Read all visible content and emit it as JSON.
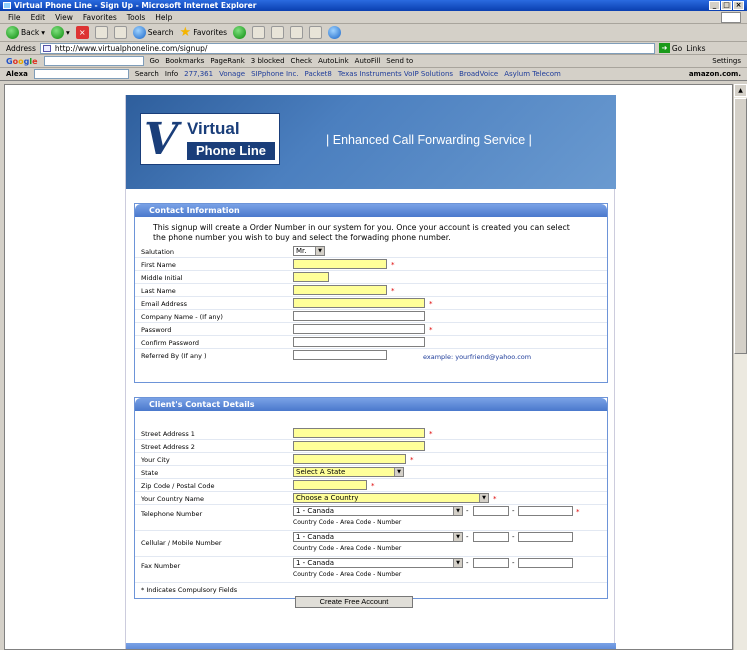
{
  "window": {
    "title": "Virtual Phone Line - Sign Up - Microsoft Internet Explorer"
  },
  "menu": [
    "File",
    "Edit",
    "View",
    "Favorites",
    "Tools",
    "Help"
  ],
  "toolbar": {
    "back": "Back",
    "search": "Search",
    "favorites": "Favorites"
  },
  "address": {
    "label": "Address",
    "url": "http://www.virtualphoneline.com/signup/",
    "go": "Go",
    "links": "Links"
  },
  "google_bar": {
    "go": "Go",
    "bookmarks": "Bookmarks",
    "pagerank": "PageRank",
    "blocked": "3 blocked",
    "check": "Check",
    "autolink": "AutoLink",
    "autofill": "AutoFill",
    "sendto": "Send to",
    "settings": "Settings"
  },
  "alexa_bar": {
    "label": "Alexa",
    "search": "Search",
    "info": "Info",
    "rank": "277,361",
    "links": [
      "Vonage",
      "SIPphone Inc.",
      "Packet8",
      "Texas Instruments VoIP Solutions",
      "BroadVoice",
      "Asylum Telecom"
    ],
    "amazon": "amazon.com."
  },
  "header": {
    "logo_line1": "Virtual",
    "logo_line2": "Phone Line",
    "tagline": "Enhanced Call Forwarding Service"
  },
  "contact": {
    "title": "Contact Information",
    "intro": "This signup will create a Order Number in our system for you. Once your account is created you can select the phone number you wish to buy and select the forwading phone number.",
    "salutation_label": "Salutation",
    "salutation_value": "Mr.",
    "first_name": "First Name",
    "middle_initial": "Middle Initial",
    "last_name": "Last Name",
    "email": "Email Address",
    "company": "Company Name - (If any)",
    "password": "Password",
    "confirm_password": "Confirm Password",
    "referred_by": "Referred By (If any )",
    "referred_example": "example: yourfriend@yahoo.com"
  },
  "client": {
    "title": "Client's Contact Details",
    "street1": "Street Address 1",
    "street2": "Street Address 2",
    "city": "Your City",
    "state": "State",
    "state_value": "Select A State",
    "zip": "Zip Code / Postal Code",
    "country": "Your Country Name",
    "country_value": "Choose a Country",
    "telephone": "Telephone Number",
    "cellular": "Cellular / Mobile Number",
    "fax": "Fax Number",
    "country_code_value": "1 - Canada",
    "phone_hint": "Country Code - Area Code - Number",
    "dash": "-",
    "required_note": "* Indicates Compulsory Fields",
    "submit": "Create Free Account"
  }
}
